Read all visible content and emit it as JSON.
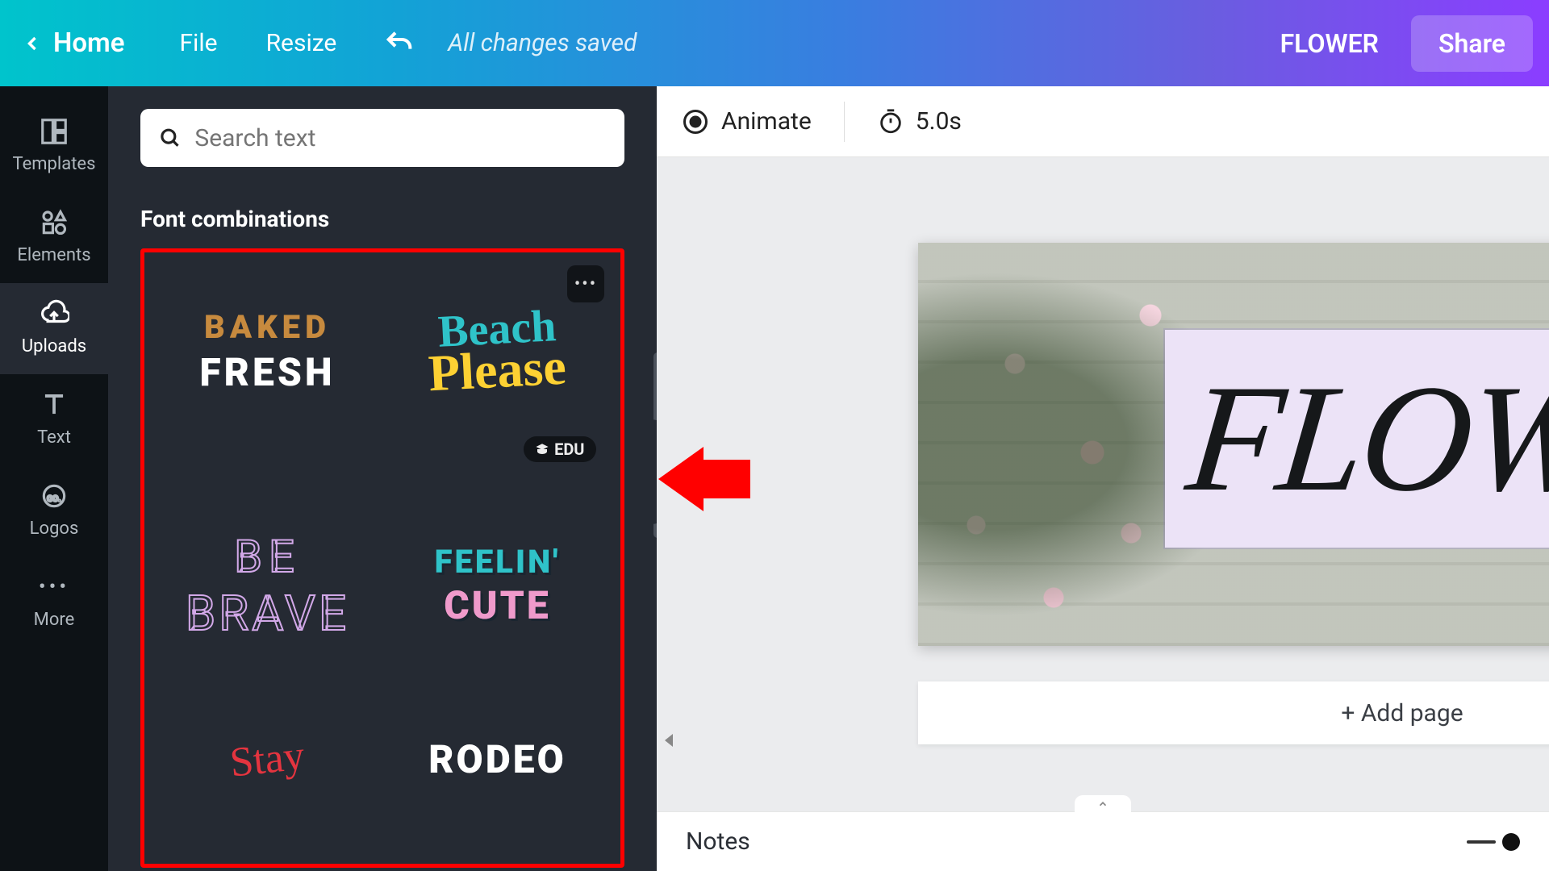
{
  "topbar": {
    "home": "Home",
    "file": "File",
    "resize": "Resize",
    "saved": "All changes saved",
    "doc_name": "FLOWER",
    "share": "Share"
  },
  "rail": {
    "templates": "Templates",
    "elements": "Elements",
    "uploads": "Uploads",
    "text": "Text",
    "logos": "Logos",
    "more": "More"
  },
  "panel": {
    "search_placeholder": "Search text",
    "section_title": "Font combinations",
    "edu_badge": "EDU",
    "combos": {
      "baked_line1": "BAKED",
      "baked_line2": "FRESH",
      "beach_line1": "Beach",
      "beach_line2": "Please",
      "be_line1": "BE",
      "be_line2": "BRAVE",
      "feelin_line1": "FEELIN'",
      "feelin_line2": "CUTE",
      "stay": "Stay",
      "rodeo": "RODEO"
    }
  },
  "toolbar": {
    "animate": "Animate",
    "duration": "5.0s"
  },
  "canvas": {
    "text": "FLOWER",
    "add_page": "+ Add page"
  },
  "notes": {
    "label": "Notes"
  }
}
